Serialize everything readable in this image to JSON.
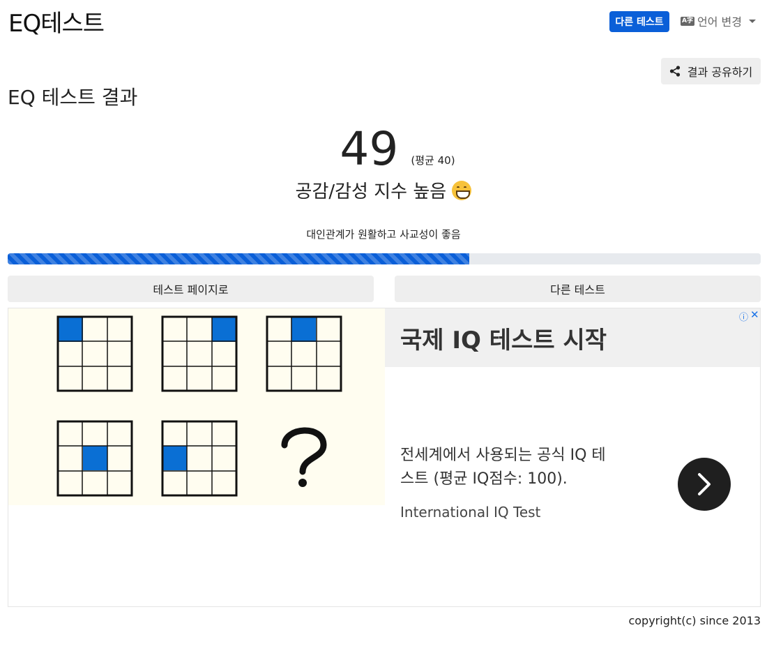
{
  "header": {
    "brand": "EQ테스트",
    "other_test_button": "다른 테스트",
    "language_label": "언어 변경",
    "language_icon": "translate-icon"
  },
  "share": {
    "label": "결과 공유하기",
    "icon": "share-icon"
  },
  "result": {
    "title": "EQ 테스트 결과",
    "score": "49",
    "average": "(평균 40)",
    "level": "공감/감성 지수 높음",
    "level_emoji": "grinning-face-icon",
    "description": "대인관계가 원활하고 사교성이 좋음",
    "progress_fraction": 0.613
  },
  "nav": {
    "test_page": "테스트 페이지로",
    "other_test": "다른 테스트"
  },
  "ad": {
    "title": "국제 IQ 테스트 시작",
    "body": "전세계에서 사용되는 공식 IQ 테스트 (평균 IQ점수: 100).",
    "source": "International IQ Test",
    "info_icon": "ⓘ",
    "close_icon": "✕"
  },
  "footer": {
    "copyright": "copyright(c) since 2013"
  },
  "colors": {
    "primary": "#0a5fd8",
    "button_bg": "#eeeeee",
    "progress_track": "#e7eaee"
  }
}
